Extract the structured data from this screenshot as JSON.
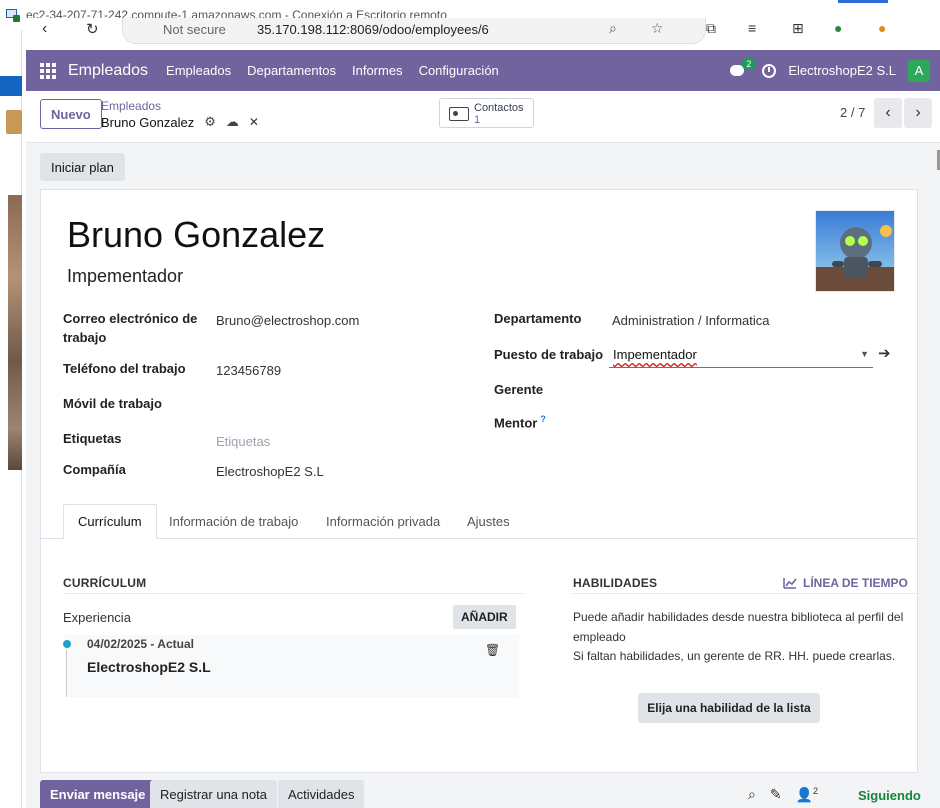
{
  "window": {
    "title": "ec2-34-207-71-242.compute-1.amazonaws.com - Conexión a Escritorio remoto"
  },
  "browser": {
    "security_label": "Not secure",
    "url": "35.170.198.112:8069/odoo/employees/6"
  },
  "navbar": {
    "app_name": "Empleados",
    "menu": [
      "Empleados",
      "Departamentos",
      "Informes",
      "Configuración"
    ],
    "messages_badge": "2",
    "company": "ElectroshopE2 S.L",
    "user_initial": "A",
    "colors": {
      "primary": "#71639e",
      "user_avatar": "#2ca858"
    }
  },
  "control_panel": {
    "new_button": "Nuevo",
    "breadcrumb_parent": "Empleados",
    "breadcrumb_current": "Bruno Gonzalez",
    "contacts_label": "Contactos",
    "contacts_count": "1",
    "pager": "2 / 7"
  },
  "actions": {
    "start_plan": "Iniciar plan"
  },
  "employee": {
    "name": "Bruno Gonzalez",
    "job_title": "Impementador",
    "fields_left": [
      {
        "label": "Correo electrónico de trabajo",
        "value": "Bruno@electroshop.com"
      },
      {
        "label": "Teléfono del trabajo",
        "value": "123456789"
      },
      {
        "label": "Móvil de trabajo",
        "value": ""
      },
      {
        "label": "Etiquetas",
        "placeholder": "Etiquetas"
      },
      {
        "label": "Compañía",
        "value": "ElectroshopE2 S.L"
      }
    ],
    "fields_right": [
      {
        "label": "Departamento",
        "value": "Administration / Informatica"
      },
      {
        "label": "Puesto de trabajo",
        "value": "Impementador"
      },
      {
        "label": "Gerente",
        "value": ""
      },
      {
        "label": "Mentor",
        "help": "?"
      }
    ]
  },
  "tabs": [
    "Currículum",
    "Información de trabajo",
    "Información privada",
    "Ajustes"
  ],
  "resume": {
    "section_title": "CURRÍCULUM",
    "group_label": "Experiencia",
    "add_button": "AÑADIR",
    "entries": [
      {
        "date": "04/02/2025 - Actual",
        "company": "ElectroshopE2 S.L"
      }
    ]
  },
  "skills": {
    "section_title": "HABILIDADES",
    "timeline_link": "LÍNEA DE TIEMPO",
    "text_line1": "Puede añadir habilidades desde nuestra biblioteca al perfil del empleado",
    "text_line2": "Si faltan habilidades, un gerente de RR. HH. puede crearlas.",
    "pick_button": "Elija una habilidad de la lista"
  },
  "chatter": {
    "send_message": "Enviar mensaje",
    "log_note": "Registrar una nota",
    "activities": "Actividades",
    "followers_count": "2",
    "following": "Siguiendo"
  }
}
